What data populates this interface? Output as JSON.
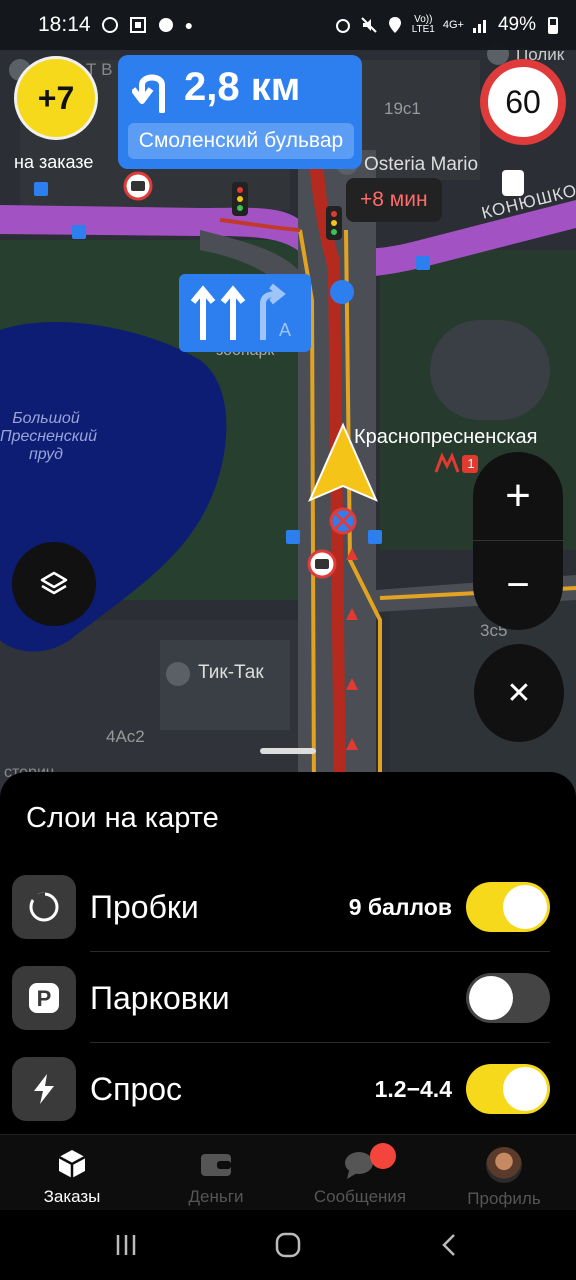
{
  "status_bar": {
    "time": "18:14",
    "network_top": "Vo))",
    "network_bottom": "LTE1",
    "generation": "4G+",
    "battery": "49%"
  },
  "orders_badge": {
    "count": "+7",
    "caption": "на заказе"
  },
  "navigation": {
    "distance": "2,8 км",
    "street": "Смоленский бульвар",
    "speed_limit": "60",
    "delay": "+8 мин",
    "lane_label": "A"
  },
  "map_labels": {
    "pond": [
      "Большой",
      "Пресненский",
      "пруд"
    ],
    "metro_station": "Краснопресненская",
    "metro_line": "1",
    "venue_1": "Osteria Mario",
    "venue_2": "Тик-Так",
    "street_1": "КОНЮШКО",
    "zoo": "зоопарк",
    "building_1": "19с1",
    "building_2": "3с5",
    "building_3": "4Ас2",
    "partial_top_left": "Т В",
    "partial_top_right": "Полик",
    "partial_bottom_left": "сторич"
  },
  "controls": {
    "zoom_in": "+",
    "zoom_out": "−",
    "close": "✕"
  },
  "layers_sheet": {
    "title": "Слои на карте",
    "items": [
      {
        "icon": "traffic-icon",
        "label": "Пробки",
        "value": "9 баллов",
        "enabled": true
      },
      {
        "icon": "parking-icon",
        "label": "Парковки",
        "value": "",
        "enabled": false
      },
      {
        "icon": "lightning-icon",
        "label": "Спрос",
        "value": "1.2−4.4",
        "enabled": true
      }
    ]
  },
  "tabs": [
    {
      "icon": "cube-icon",
      "label": "Заказы",
      "active": true
    },
    {
      "icon": "wallet-icon",
      "label": "Деньги",
      "active": false
    },
    {
      "icon": "chat-icon",
      "label": "Сообщения",
      "active": false
    },
    {
      "icon": "avatar",
      "label": "Профиль",
      "active": false
    }
  ],
  "colors": {
    "accent_yellow": "#f5d91a",
    "nav_blue": "#2d7ff0",
    "traffic_red": "#b52a1f",
    "speed_red": "#e03b3b",
    "route_purple": "#a352c4",
    "notification": "#f4453c"
  }
}
